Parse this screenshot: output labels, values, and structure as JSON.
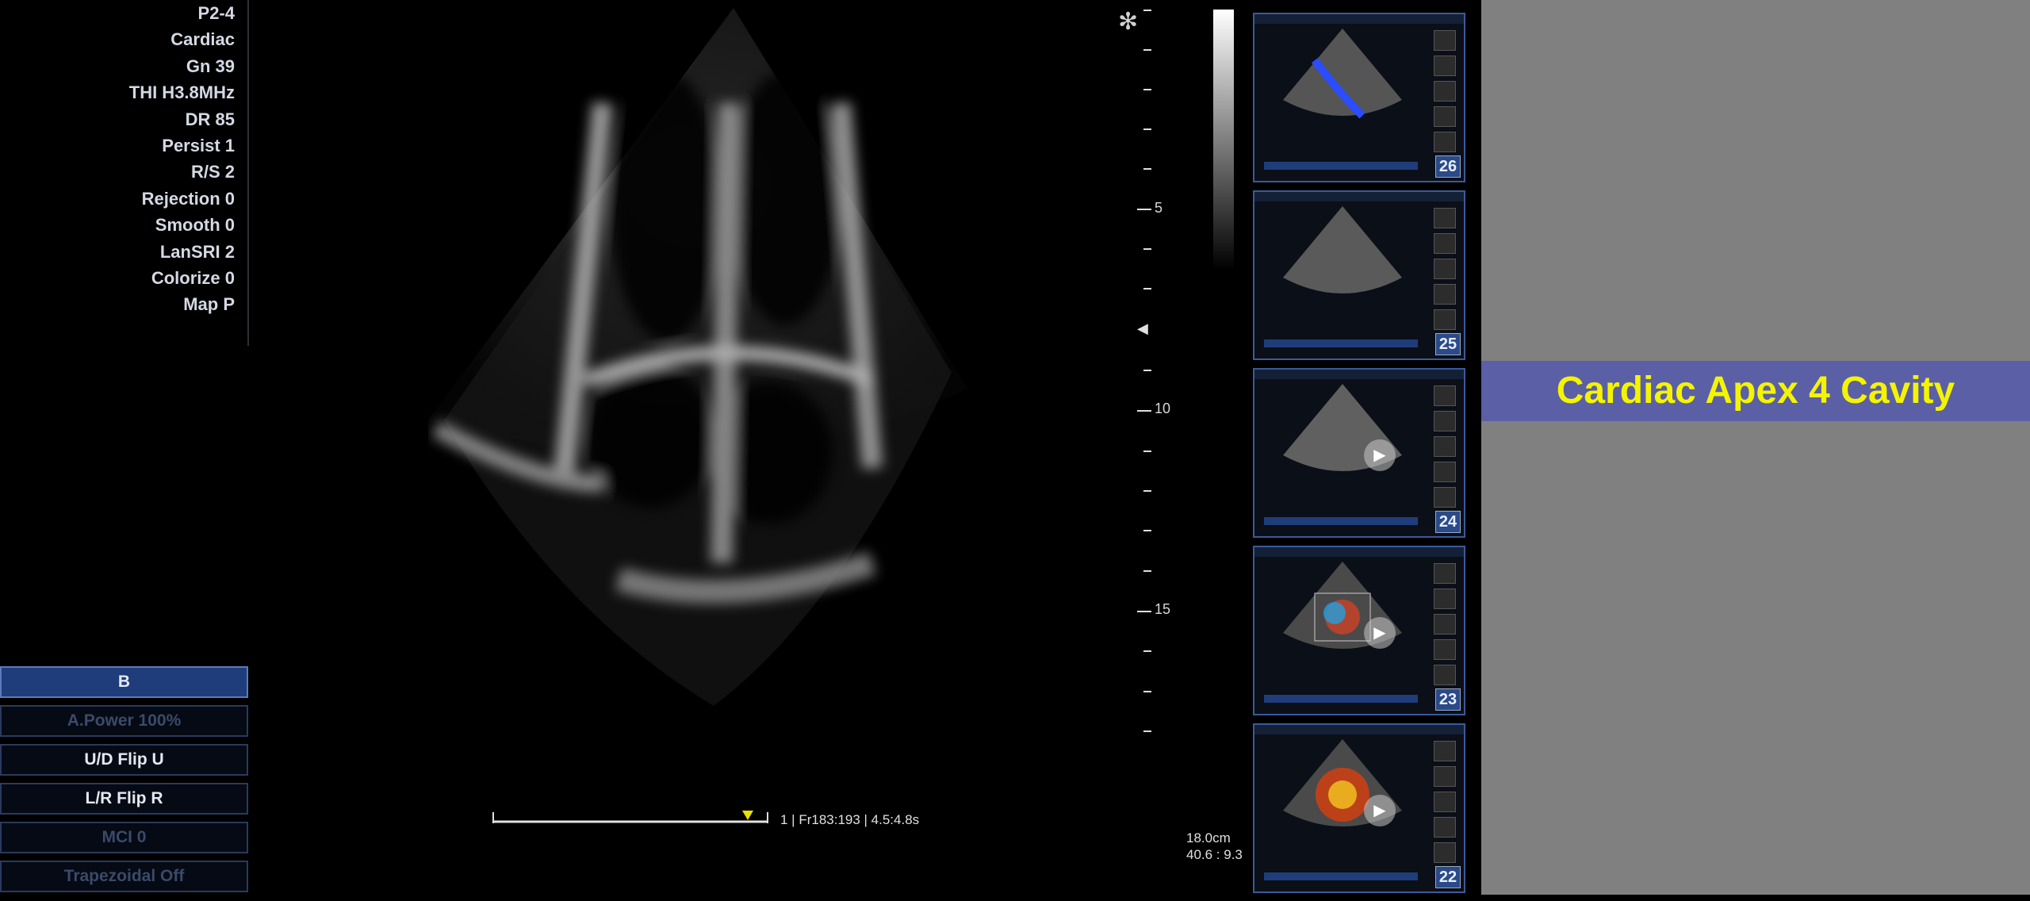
{
  "params": [
    "P2-4",
    "Cardiac",
    "Gn 39",
    "THI H3.8MHz",
    "DR 85",
    "Persist 1",
    "R/S 2",
    "Rejection 0",
    "Smooth 0",
    "LanSRI 2",
    "Colorize 0",
    "Map P"
  ],
  "controls": {
    "b_mode": "B",
    "acoustic_power": "A.Power 100%",
    "ud_flip": "U/D Flip  U",
    "lr_flip": "L/R Flip  R",
    "mci": "MCI 0",
    "trapezoidal": "Trapezoidal  Off"
  },
  "depth_scale": {
    "labels": [
      "5",
      "10",
      "15"
    ]
  },
  "frame_info": "1 | Fr183:193 | 4.5:4.8s",
  "readout": {
    "depth": "18.0cm",
    "ratio": "40.6 : 9.3"
  },
  "thumbnails": [
    {
      "number": "26",
      "mode": "color-flow-blue",
      "play": false
    },
    {
      "number": "25",
      "mode": "b-mode",
      "play": false
    },
    {
      "number": "24",
      "mode": "b-mode",
      "play": true
    },
    {
      "number": "23",
      "mode": "color-flow",
      "play": true
    },
    {
      "number": "22",
      "mode": "power-doppler",
      "play": true
    }
  ],
  "banner": "Cardiac Apex 4 Cavity",
  "colors": {
    "accent": "#1f3d7a",
    "banner_bg": "#5b5fa6",
    "banner_text": "#f4f400",
    "side_bg": "#808080"
  }
}
